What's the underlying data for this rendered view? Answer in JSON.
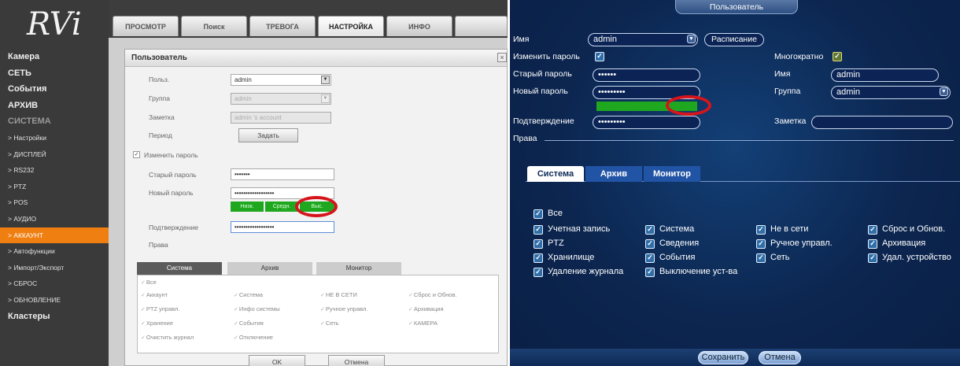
{
  "left": {
    "logo": "RVi",
    "tabs": [
      "ПРОСМОТР",
      "Поиск",
      "ТРЕВОГА",
      "НАСТРОЙКА",
      "ИНФО"
    ],
    "sidebar": [
      {
        "label": "Камера",
        "style": "bold"
      },
      {
        "label": "СЕТЬ",
        "style": "bold"
      },
      {
        "label": "События",
        "style": "bold"
      },
      {
        "label": "АРХИВ",
        "style": "bold"
      },
      {
        "label": "СИСТЕМА",
        "style": "dim"
      },
      {
        "label": "> Настройки",
        "style": "small"
      },
      {
        "label": "> ДИСПЛЕЙ",
        "style": "small"
      },
      {
        "label": "> RS232",
        "style": "small"
      },
      {
        "label": "> PTZ",
        "style": "small"
      },
      {
        "label": "> POS",
        "style": "small"
      },
      {
        "label": "> АУДИО",
        "style": "small"
      },
      {
        "label": "> АККАУНТ",
        "style": "small active"
      },
      {
        "label": "> Автофункции",
        "style": "small"
      },
      {
        "label": "> Импорт/Экспорт",
        "style": "small"
      },
      {
        "label": "> СБРОС",
        "style": "small"
      },
      {
        "label": "> ОБНОВЛЕНИЕ",
        "style": "small"
      },
      {
        "label": "Кластеры",
        "style": "bold"
      }
    ],
    "dialog": {
      "title": "Пользователь",
      "close": "×",
      "user_label": "Польз.",
      "user_value": "admin",
      "group_label": "Группа",
      "group_value": "admin",
      "note_label": "Заметка",
      "note_value": "admin 's account",
      "period_label": "Период",
      "set_button": "Задать",
      "change_password_label": "Изменить пароль",
      "old_password_label": "Старый пароль",
      "old_password_value": "•••••••",
      "new_password_label": "Новый пароль",
      "new_password_value": "••••••••••••••••••",
      "strength": [
        "Низк.",
        "Средн.",
        "Выс."
      ],
      "confirm_label": "Подтверждение",
      "confirm_value": "••••••••••••••••••",
      "rights_label": "Права",
      "rights_tabs": [
        "Система",
        "Архив",
        "Монитор"
      ],
      "rights_all": "Все",
      "rights": [
        [
          "Аккаунт",
          "Система",
          "НЕ В СЕТИ",
          "Сброс и Обнов."
        ],
        [
          "PTZ управл.",
          "Инфо системы",
          "Ручное управл.",
          "Архивация"
        ],
        [
          "Хранение",
          "События",
          "Сеть",
          "КАМЕРА"
        ],
        [
          "Очистить журнал",
          "Отключение",
          "",
          ""
        ]
      ],
      "ok_button": "OK",
      "cancel_button": "Отмена"
    }
  },
  "right": {
    "title": "Пользователь",
    "name_label": "Имя",
    "name_value": "admin",
    "schedule_button": "Расписание",
    "change_password_label": "Изменить пароль",
    "multi_label": "Многократно",
    "old_password_label": "Старый пароль",
    "old_password_value": "••••••",
    "new_password_label": "Новый пароль",
    "new_password_value": "•••••••••",
    "confirm_label": "Подтверждение",
    "confirm_value": "•••••••••",
    "rights_label": "Права",
    "name2_label": "Имя",
    "name2_value": "admin",
    "group_label": "Группа",
    "group_value": "admin",
    "note_label": "Заметка",
    "note_value": "",
    "tabs": [
      "Система",
      "Архив",
      "Монитор"
    ],
    "all_label": "Все",
    "perms": [
      [
        "Учетная запись",
        "Система",
        "Не в сети",
        "Сброс и Обнов."
      ],
      [
        "PTZ",
        "Сведения",
        "Ручное управл.",
        "Архивация"
      ],
      [
        "Хранилище",
        "События",
        "Сеть",
        "Удал. устройство"
      ],
      [
        "Удаление журнала",
        "Выключение уст-ва",
        "",
        ""
      ]
    ],
    "save_button": "Сохранить",
    "cancel_button": "Отмена",
    "colors": {
      "background": "#0d2a57",
      "checkbox": "#2f6ea8",
      "strength": "#1fa81f",
      "highlight": "#d5151b"
    }
  }
}
